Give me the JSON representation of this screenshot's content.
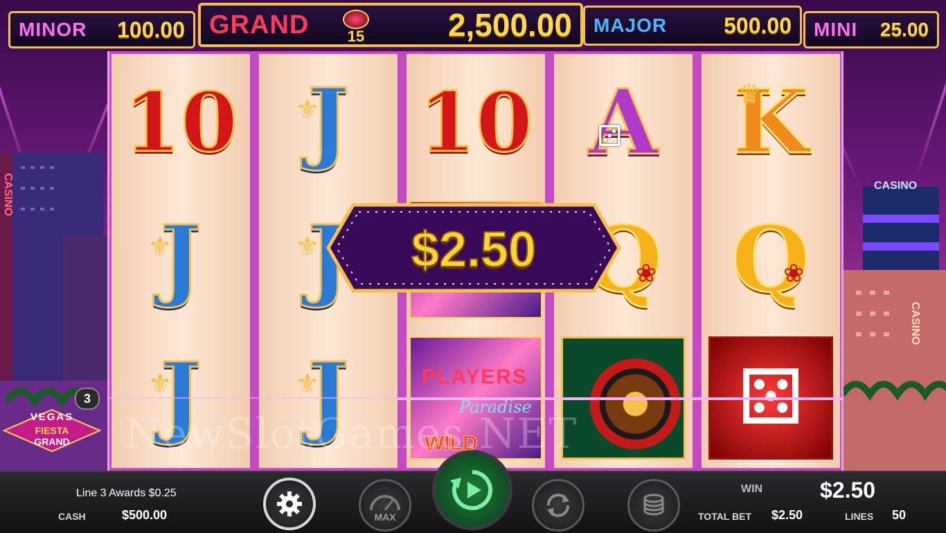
{
  "jackpots": {
    "minor": {
      "name": "MINOR",
      "value": "100.00"
    },
    "grand": {
      "name": "GRAND",
      "value": "2,500.00",
      "badge": "15"
    },
    "major": {
      "name": "MAJOR",
      "value": "500.00"
    },
    "mini": {
      "name": "MINI",
      "value": "25.00"
    }
  },
  "reels": [
    {
      "symbols": [
        "10",
        "J",
        "J"
      ]
    },
    {
      "symbols": [
        "J",
        "J",
        "J"
      ]
    },
    {
      "symbols": [
        "10",
        "WILD",
        "PLAYERS Paradise WILD"
      ]
    },
    {
      "symbols": [
        "A",
        "Q",
        "roulette"
      ]
    },
    {
      "symbols": [
        "K",
        "Q",
        "dice"
      ]
    }
  ],
  "wild_tile": {
    "players": "PLAYERS",
    "paradise": "Paradise",
    "wild": "WILD"
  },
  "win_popup": {
    "amount": "$2.50"
  },
  "logo": {
    "line1": "VEGAS",
    "line2": "FIESTA",
    "line3": "GRAND"
  },
  "line_badge": "3",
  "casino_signs": {
    "left_vertical": "CASINO",
    "right_top": "CASINO",
    "right_vertical": "CASINO"
  },
  "watermark": "NewSlotGames.NET",
  "status": {
    "message": "Line 3 Awards $0.25",
    "cash_label": "CASH",
    "cash_value": "$500.00",
    "win_label": "WIN",
    "win_value": "$2.50",
    "total_bet_label": "TOTAL BET",
    "total_bet_value": "$2.50",
    "lines_label": "LINES",
    "lines_value": "50"
  },
  "controls": {
    "settings_icon": "gear-icon",
    "max_label": "MAX",
    "spin_icon": "spin-play-icon",
    "autoplay_icon": "autoplay-icon",
    "coins_icon": "coin-stack-icon"
  },
  "colors": {
    "jackpot_gold": "#ffd84a",
    "grand_red": "#ff3a5a",
    "major_blue": "#4ab8ff",
    "spin_green": "#1f7a3a"
  }
}
